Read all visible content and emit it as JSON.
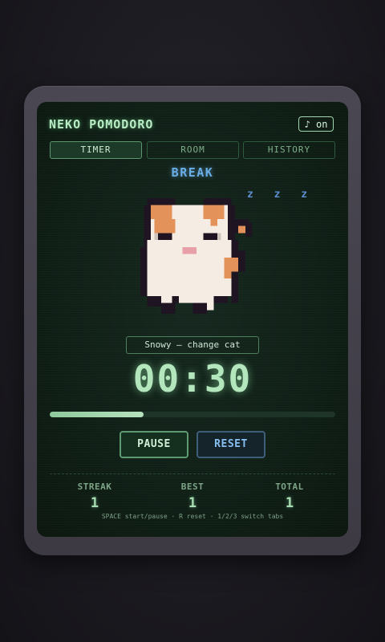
{
  "app": {
    "title": "NEKO POMODORO"
  },
  "sound_toggle": {
    "label": "♪ on"
  },
  "tabs": [
    {
      "label": "TIMER",
      "active": true
    },
    {
      "label": "ROOM",
      "active": false
    },
    {
      "label": "HISTORY",
      "active": false
    }
  ],
  "mode": {
    "label": "BREAK"
  },
  "sleep_indicator": {
    "text": "z z z"
  },
  "cat": {
    "name_button": "Snowy — change cat",
    "icon": "pixel-calico-cat"
  },
  "timer": {
    "display": "00:30",
    "progress_percent": 33
  },
  "controls": {
    "pause_label": "PAUSE",
    "reset_label": "RESET"
  },
  "stats": [
    {
      "label": "STREAK",
      "value": "1"
    },
    {
      "label": "BEST",
      "value": "1"
    },
    {
      "label": "TOTAL",
      "value": "1"
    }
  ],
  "hint": "SPACE start/pause · R reset · 1/2/3 switch tabs",
  "colors": {
    "accent_green": "#b3e6bd",
    "accent_blue": "#6aaee6",
    "screen_bg": "#102017"
  }
}
